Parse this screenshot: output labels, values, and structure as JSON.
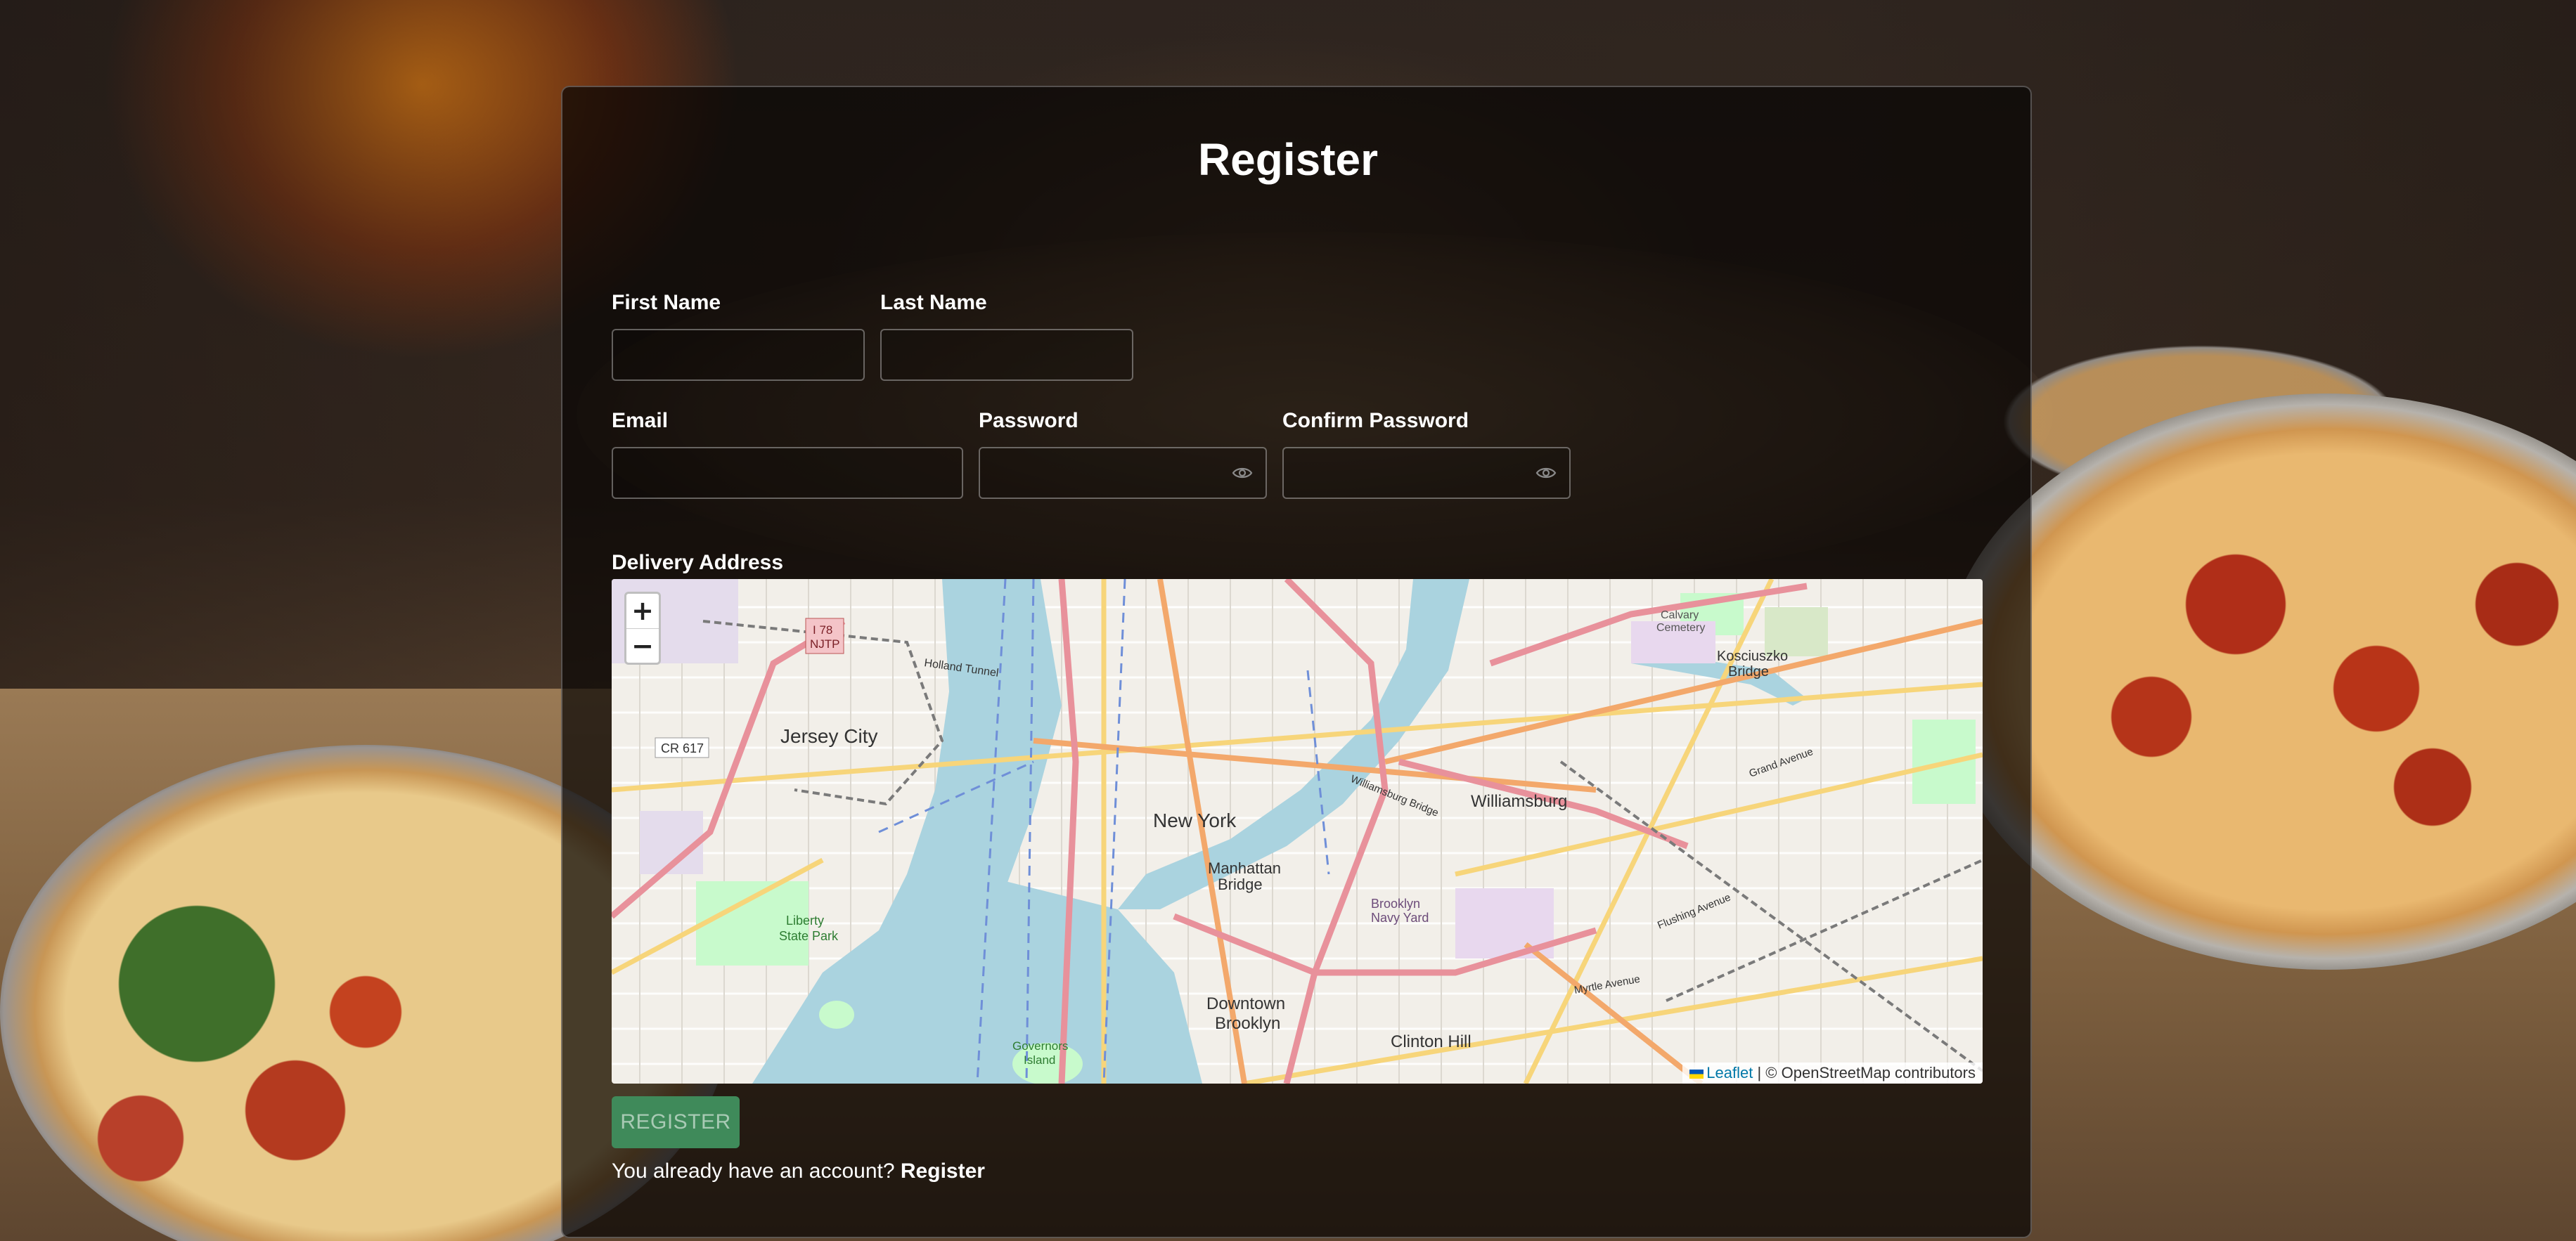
{
  "page": {
    "title": "Register"
  },
  "form": {
    "first_name_label": "First Name",
    "last_name_label": "Last Name",
    "email_label": "Email",
    "password_label": "Password",
    "confirm_password_label": "Confirm Password",
    "first_name_value": "",
    "last_name_value": "",
    "email_value": "",
    "password_value": "",
    "confirm_password_value": "",
    "delivery_address_label": "Delivery Address"
  },
  "map": {
    "zoom_in": "+",
    "zoom_out": "−",
    "attribution_leaflet": "Leaflet",
    "attribution_rest": "| © OpenStreetMap contributors",
    "places": {
      "new_york": "New York",
      "jersey_city": "Jersey City",
      "williamsburg": "Williamsburg",
      "manhattan_bridge_1": "Manhattan",
      "manhattan_bridge_2": "Bridge",
      "downtown_brooklyn_1": "Downtown",
      "downtown_brooklyn_2": "Brooklyn",
      "clinton_hill": "Clinton Hill",
      "liberty_state_park_1": "Liberty",
      "liberty_state_park_2": "State Park",
      "brooklyn_navy_yard_1": "Brooklyn",
      "brooklyn_navy_yard_2": "Navy Yard",
      "kosciuszko_1": "Kosciuszko",
      "kosciuszko_2": "Bridge",
      "calvary_1": "Calvary",
      "calvary_2": "Cemetery",
      "governors_1": "Governors",
      "governors_2": "Island",
      "holland_tunnel": "Holland Tunnel",
      "cr617": "CR 617",
      "i78_1": "I 78",
      "i78_2": "NJTP",
      "williamsburg_bridge": "Williamsburg Bridge",
      "flushing_avenue": "Flushing Avenue",
      "myrtle_avenue": "Myrtle Avenue",
      "grand_avenue": "Grand Avenue"
    }
  },
  "actions": {
    "register_button": "REGISTER",
    "footer_text": "You already have an account?",
    "footer_link": "Register"
  },
  "colors": {
    "button_bg": "#3f8a5a",
    "water": "#aad3df",
    "leaflet_link": "#0078a8"
  },
  "icons": {
    "password_toggle": "eye-icon",
    "confirm_password_toggle": "eye-icon"
  }
}
